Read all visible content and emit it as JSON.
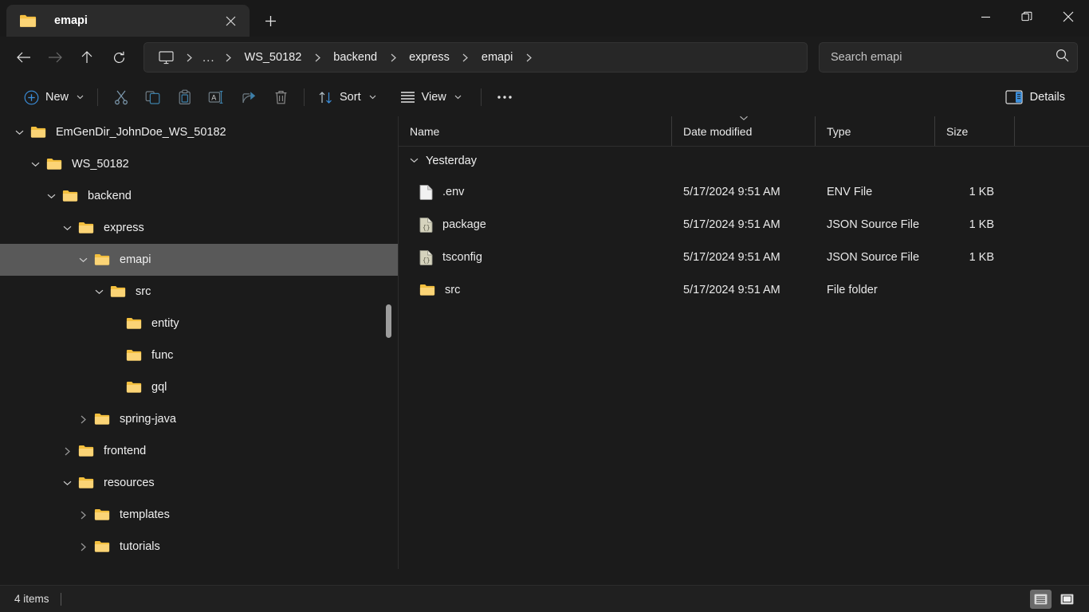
{
  "window": {
    "tab_title": "emapi",
    "tab_icon": "folder-icon",
    "new_tab_label": "+",
    "minimize_label": "Minimize",
    "maximize_label": "Restore",
    "close_label": "Close"
  },
  "address": {
    "back_label": "Back",
    "forward_label": "Forward",
    "up_label": "Up",
    "refresh_label": "Refresh",
    "pc_icon": "this-pc-icon",
    "overflow": "...",
    "breadcrumbs": [
      "WS_50182",
      "backend",
      "express",
      "emapi"
    ],
    "search_placeholder": "Search emapi",
    "search_value": "",
    "search_icon": "search-icon"
  },
  "toolbar": {
    "new_label": "New",
    "cut_label": "Cut",
    "copy_label": "Copy",
    "paste_label": "Paste",
    "rename_label": "Rename",
    "share_label": "Share",
    "delete_label": "Delete",
    "sort_label": "Sort",
    "view_label": "View",
    "more_label": "See more",
    "details_label": "Details",
    "accent_color": "#3b8fdc"
  },
  "nav_tree": {
    "items": [
      {
        "label": "EmGenDir_JohnDoe_WS_50182",
        "depth": 1,
        "state": "expanded",
        "selected": false
      },
      {
        "label": "WS_50182",
        "depth": 2,
        "state": "expanded",
        "selected": false
      },
      {
        "label": "backend",
        "depth": 3,
        "state": "expanded",
        "selected": false
      },
      {
        "label": "express",
        "depth": 4,
        "state": "expanded",
        "selected": false
      },
      {
        "label": "emapi",
        "depth": 5,
        "state": "expanded",
        "selected": true
      },
      {
        "label": "src",
        "depth": 6,
        "state": "expanded",
        "selected": false
      },
      {
        "label": "entity",
        "depth": 7,
        "state": "leaf",
        "selected": false
      },
      {
        "label": "func",
        "depth": 7,
        "state": "leaf",
        "selected": false
      },
      {
        "label": "gql",
        "depth": 7,
        "state": "leaf",
        "selected": false
      },
      {
        "label": "spring-java",
        "depth": 5,
        "state": "collapsed",
        "selected": false
      },
      {
        "label": "frontend",
        "depth": 4,
        "state": "collapsed",
        "selected": false
      },
      {
        "label": "resources",
        "depth": 4,
        "state": "expanded",
        "selected": false
      },
      {
        "label": "templates",
        "depth": 5,
        "state": "collapsed",
        "selected": false
      },
      {
        "label": "tutorials",
        "depth": 5,
        "state": "collapsed",
        "selected": false
      }
    ]
  },
  "file_list": {
    "columns": [
      "Name",
      "Date modified",
      "Type",
      "Size"
    ],
    "sorted_column": "Date modified",
    "group_label": "Yesterday",
    "rows": [
      {
        "name": ".env",
        "date": "5/17/2024 9:51 AM",
        "type": "ENV File",
        "size": "1 KB",
        "icon": "file-icon"
      },
      {
        "name": "package",
        "date": "5/17/2024 9:51 AM",
        "type": "JSON Source File",
        "size": "1 KB",
        "icon": "json-file-icon"
      },
      {
        "name": "tsconfig",
        "date": "5/17/2024 9:51 AM",
        "type": "JSON Source File",
        "size": "1 KB",
        "icon": "json-file-icon"
      },
      {
        "name": "src",
        "date": "5/17/2024 9:51 AM",
        "type": "File folder",
        "size": "",
        "icon": "folder-icon"
      }
    ]
  },
  "status": {
    "item_count": "4 items",
    "details_view_label": "Details view",
    "large_icons_view_label": "Large icons view"
  }
}
